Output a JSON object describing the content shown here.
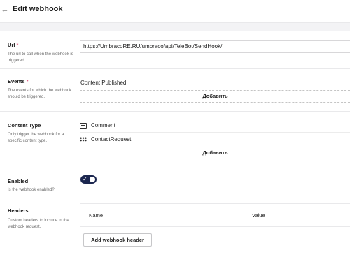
{
  "header": {
    "back_icon": "arrow-left-icon",
    "title": "Edit webhook"
  },
  "fields": {
    "url": {
      "label": "Url",
      "required_mark": "*",
      "description": "The url to call when the webhook is triggered.",
      "value": "https://UmbracoRE.RU/umbraco/api/TeleBot/SendHook/"
    },
    "events": {
      "label": "Events",
      "required_mark": "*",
      "description": "The events for which the webhook should be triggered.",
      "items": [
        "Content Published"
      ],
      "add_label": "Добавить"
    },
    "content_type": {
      "label": "Content Type",
      "description": "Only trigger the webhook for a specific content type.",
      "items": [
        {
          "label": "Comment",
          "icon": "document-icon"
        },
        {
          "label": "ContactRequest",
          "icon": "grid-icon"
        }
      ],
      "add_label": "Добавить"
    },
    "enabled": {
      "label": "Enabled",
      "description": "Is the webhook enabled?",
      "value": true,
      "check_glyph": "✓"
    },
    "headers": {
      "label": "Headers",
      "description": "Custom headers to include in the webhook request.",
      "columns": [
        "Name",
        "Value"
      ],
      "add_label": "Add webhook header"
    }
  },
  "colors": {
    "accent": "#1b264f",
    "required": "#d42054"
  }
}
